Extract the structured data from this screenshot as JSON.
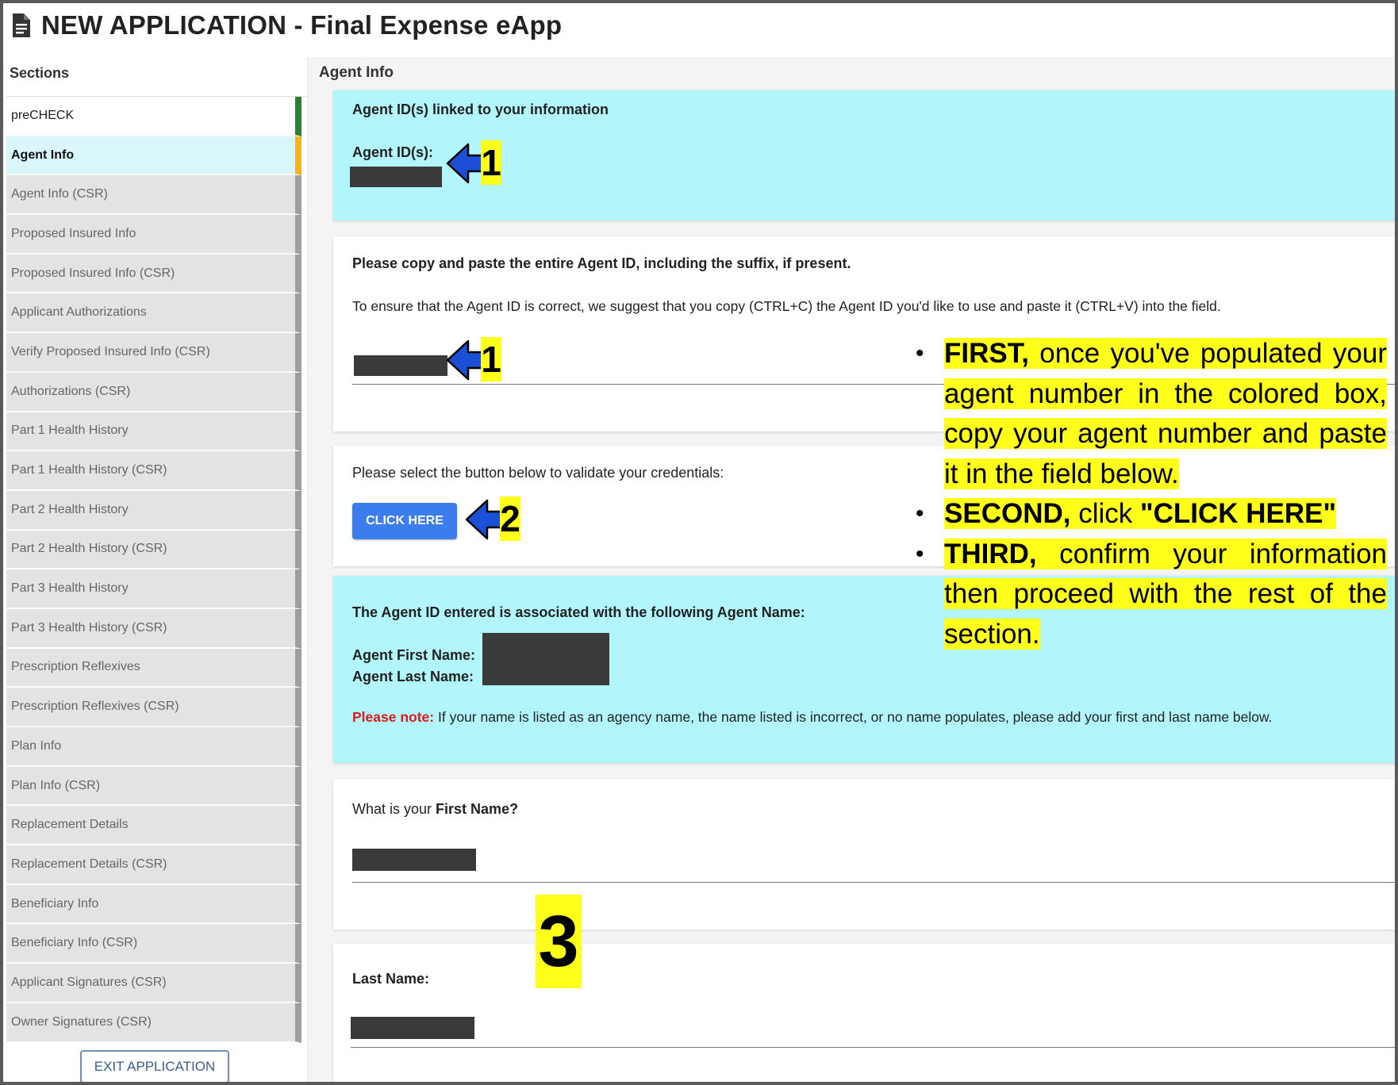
{
  "window": {
    "title": "NEW APPLICATION - Final Expense eApp",
    "icon": "document-icon"
  },
  "sidebar": {
    "heading": "Sections",
    "items": [
      {
        "label": "preCHECK",
        "state": "complete"
      },
      {
        "label": "Agent Info",
        "state": "active"
      },
      {
        "label": "Agent Info (CSR)"
      },
      {
        "label": "Proposed Insured Info"
      },
      {
        "label": "Proposed Insured Info (CSR)"
      },
      {
        "label": "Applicant Authorizations"
      },
      {
        "label": "Verify Proposed Insured Info (CSR)"
      },
      {
        "label": "Authorizations (CSR)"
      },
      {
        "label": "Part 1 Health History"
      },
      {
        "label": "Part 1 Health History (CSR)"
      },
      {
        "label": "Part 2 Health History"
      },
      {
        "label": "Part 2 Health History (CSR)"
      },
      {
        "label": "Part 3 Health History"
      },
      {
        "label": "Part 3 Health History (CSR)"
      },
      {
        "label": "Prescription Reflexives"
      },
      {
        "label": "Prescription Reflexives (CSR)"
      },
      {
        "label": "Plan Info"
      },
      {
        "label": "Plan Info (CSR)"
      },
      {
        "label": "Replacement Details"
      },
      {
        "label": "Replacement Details (CSR)"
      },
      {
        "label": "Beneficiary Info"
      },
      {
        "label": "Beneficiary Info (CSR)"
      },
      {
        "label": "Applicant Signatures (CSR)"
      },
      {
        "label": "Owner Signatures (CSR)"
      }
    ],
    "exit_label": "EXIT APPLICATION"
  },
  "main": {
    "heading": "Agent Info",
    "agent_ids": {
      "title": "Agent ID(s) linked to your information",
      "label": "Agent ID(s):",
      "value_redacted": true
    },
    "copy_paste": {
      "title": "Please copy and paste the entire Agent ID, including the suffix, if present.",
      "hint": "To ensure that the Agent ID is correct, we suggest that you copy (CTRL+C) the Agent ID you'd like to use and paste it (CTRL+V) into the field.",
      "field_redacted": true
    },
    "validate": {
      "prompt": "Please select the button below to validate your credentials:",
      "button_label": "CLICK HERE"
    },
    "associated": {
      "title": "The Agent ID entered is associated with the following Agent Name:",
      "first_label": "Agent First Name:",
      "last_label": "Agent Last Name:",
      "note_label": "Please note:",
      "note_text": "If your name is listed as an agency name, the name listed is incorrect, or no name populates, please add your first and last name below."
    },
    "first_name": {
      "question_prefix": "What is your ",
      "question_bold": "First Name?"
    },
    "last_name": {
      "label": "Last Name:"
    }
  },
  "annotations": {
    "step1": "1",
    "step2": "2",
    "step3": "3",
    "arrow_color": "#1a4fd6",
    "highlight_color": "#ffff1a",
    "instructions": [
      {
        "bold": "FIRST,",
        "text": " once you've populated your agent number in the colored box, copy your agent number and paste it in the field below."
      },
      {
        "bold": "SECOND,",
        "text": " click ",
        "bold2": "\"CLICK HERE\""
      },
      {
        "bold": "THIRD,",
        "text": " confirm your information then proceed with the rest of the section."
      }
    ]
  }
}
